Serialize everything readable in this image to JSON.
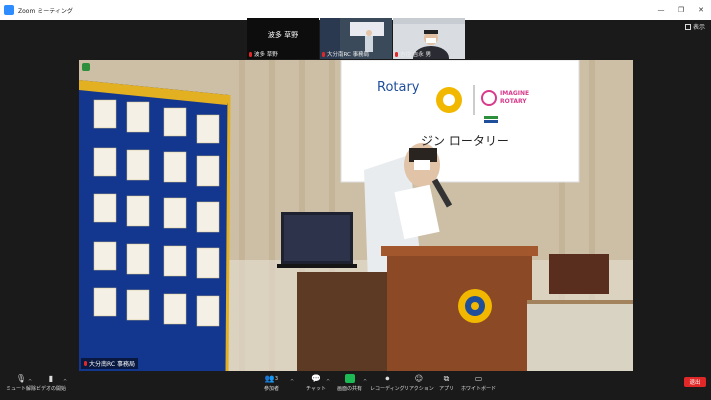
{
  "window": {
    "title": "Zoom ミーティング",
    "min": "—",
    "restore": "❐",
    "close": "✕"
  },
  "view_button": {
    "label": "表示"
  },
  "thumbnails": [
    {
      "big_name": "波多 草野",
      "name": "波多 草野"
    },
    {
      "name": "大分南RC 事務局"
    },
    {
      "name": "吉住 吉永 男"
    }
  ],
  "main_video": {
    "label": "大分南RC 事務局",
    "banner_logo": "Rotary",
    "banner_imagine": "IMAGINE",
    "banner_rotary": "ROTARY",
    "banner_jp": "ジン ロータリー"
  },
  "toolbar": {
    "unmute": "ミュート解除",
    "video": "ビデオの開始",
    "participants": "参加者",
    "participants_count": "3",
    "chat": "チャット",
    "share": "画面の共有",
    "record": "レコーディング",
    "reactions": "リアクション",
    "apps": "アプリ",
    "whiteboard": "ホワイトボード",
    "end": "退出"
  },
  "colors": {
    "accent": "#2d8cff",
    "end": "#e02828",
    "share": "#1db954",
    "banner_blue": "#1f4e9a",
    "gold": "#f2b800"
  }
}
